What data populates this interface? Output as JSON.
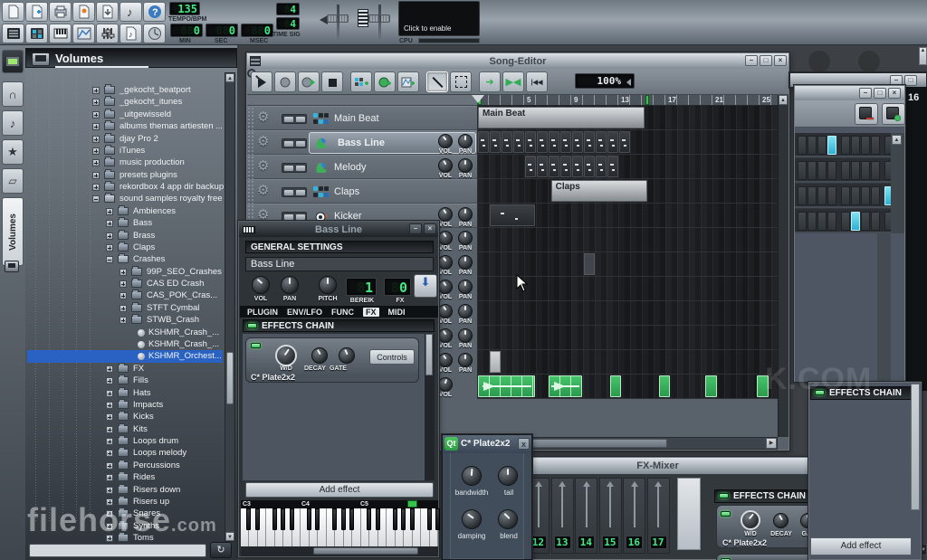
{
  "colors": {
    "accent_blue": "#2a62c4",
    "led_green": "#49e06a",
    "lcd_green": "#43e883",
    "sample_green": "#2fae54",
    "step_cyan": "#45c8e6"
  },
  "toolbar": {
    "row1_icons": [
      "new-project",
      "open-project",
      "save-project",
      "project-versions",
      "export-project",
      "export-midi",
      "help"
    ],
    "row2_icons": [
      "song-editor-toggle",
      "bb-editor-toggle",
      "piano-roll-toggle",
      "automation-editor-toggle",
      "fx-mixer-toggle",
      "project-notes-toggle",
      "controller-rack-toggle"
    ],
    "tempo": {
      "value": "135",
      "label": "TEMPO/BPM"
    },
    "counters": [
      {
        "value": "0",
        "label": "MIN"
      },
      {
        "value": "0",
        "label": "SEC"
      },
      {
        "value": "0",
        "label": "MSEC"
      }
    ],
    "timesig": {
      "num": "4",
      "den": "4",
      "label": "TIME SIG"
    },
    "master_sliders": [
      "master-volume",
      "master-pitch"
    ],
    "visualizer": {
      "text": "Click to enable"
    },
    "cpu": {
      "label": "CPU"
    }
  },
  "browser": {
    "title": "Volumes",
    "rail_icons": [
      "instrument-plugins",
      "samples-headphones",
      "presets-note",
      "favorites-star",
      "home-folder"
    ],
    "rail_tab_label": "Volumes",
    "search_value": "",
    "tree": [
      {
        "label": "_gekocht_beatport",
        "depth": 5,
        "icon": "folder"
      },
      {
        "label": "_gekocht_itunes",
        "depth": 5,
        "icon": "folder"
      },
      {
        "label": "_uitgewisseld",
        "depth": 5,
        "icon": "folder"
      },
      {
        "label": "albums themas artiesten ...",
        "depth": 5,
        "icon": "folder"
      },
      {
        "label": "djay Pro 2",
        "depth": 5,
        "icon": "folder"
      },
      {
        "label": "iTunes",
        "depth": 5,
        "icon": "folder"
      },
      {
        "label": "music production",
        "depth": 5,
        "icon": "folder"
      },
      {
        "label": "presets plugins",
        "depth": 5,
        "icon": "folder"
      },
      {
        "label": "rekordbox 4 app dir backup",
        "depth": 5,
        "icon": "folder"
      },
      {
        "label": "sound samples royalty free",
        "depth": 5,
        "icon": "folder-open"
      },
      {
        "label": "Ambiences",
        "depth": 6,
        "icon": "folder"
      },
      {
        "label": "Bass",
        "depth": 6,
        "icon": "folder"
      },
      {
        "label": "Brass",
        "depth": 6,
        "icon": "folder"
      },
      {
        "label": "Claps",
        "depth": 6,
        "icon": "folder"
      },
      {
        "label": "Crashes",
        "depth": 6,
        "icon": "folder-open"
      },
      {
        "label": "99P_SEO_Crashes",
        "depth": 7,
        "icon": "folder"
      },
      {
        "label": "CAS ED Crash",
        "depth": 7,
        "icon": "folder"
      },
      {
        "label": "CAS_POK_Cras...",
        "depth": 7,
        "icon": "folder"
      },
      {
        "label": "STFT Cymbal",
        "depth": 7,
        "icon": "folder"
      },
      {
        "label": "STWB_Crash",
        "depth": 7,
        "icon": "folder"
      },
      {
        "label": "KSHMR_Crash_...",
        "depth": 8,
        "icon": "sample"
      },
      {
        "label": "KSHMR_Crash_...",
        "depth": 8,
        "icon": "sample"
      },
      {
        "label": "KSHMR_Orchest...",
        "depth": 8,
        "icon": "sample",
        "selected": true
      },
      {
        "label": "FX",
        "depth": 6,
        "icon": "folder"
      },
      {
        "label": "Fills",
        "depth": 6,
        "icon": "folder"
      },
      {
        "label": "Hats",
        "depth": 6,
        "icon": "folder"
      },
      {
        "label": "Impacts",
        "depth": 6,
        "icon": "folder"
      },
      {
        "label": "Kicks",
        "depth": 6,
        "icon": "folder"
      },
      {
        "label": "Kits",
        "depth": 6,
        "icon": "folder"
      },
      {
        "label": "Loops drum",
        "depth": 6,
        "icon": "folder"
      },
      {
        "label": "Loops melody",
        "depth": 6,
        "icon": "folder"
      },
      {
        "label": "Percussions",
        "depth": 6,
        "icon": "folder"
      },
      {
        "label": "Rides",
        "depth": 6,
        "icon": "folder"
      },
      {
        "label": "Risers down",
        "depth": 6,
        "icon": "folder"
      },
      {
        "label": "Risers up",
        "depth": 6,
        "icon": "folder"
      },
      {
        "label": "Snares",
        "depth": 6,
        "icon": "folder"
      },
      {
        "label": "Synths",
        "depth": 6,
        "icon": "folder"
      },
      {
        "label": "Toms",
        "depth": 6,
        "icon": "folder"
      }
    ]
  },
  "song_editor": {
    "title": "Song-Editor",
    "toolbar_icons": [
      "play",
      "record",
      "record-play",
      "stop",
      "add-bb-track",
      "add-sample-track",
      "add-automation-track",
      "draw-mode",
      "edit-mode",
      "next-state",
      "loop-points",
      "rewind",
      "zoom"
    ],
    "zoom_value": "100%",
    "timeline_labels": [
      "5",
      "9",
      "13",
      "17",
      "21",
      "25"
    ],
    "knob_caption_vol": "VOL",
    "knob_caption_pan": "PAN",
    "tracks": [
      {
        "name": "Main Beat",
        "icon": "beat-pattern",
        "knobs": false
      },
      {
        "name": "Bass Line",
        "icon": "instrument-colorful",
        "knobs": true,
        "selected": true
      },
      {
        "name": "Melody",
        "icon": "instrument-colorful",
        "knobs": true
      },
      {
        "name": "Claps",
        "icon": "beat-pattern",
        "knobs": false
      },
      {
        "name": "Kicker",
        "icon": "kicker-ball",
        "knobs": true
      }
    ],
    "hidden_knob_rows": 6,
    "segments": [
      {
        "row": 0,
        "start": 1,
        "len": 14.2,
        "kind": "named",
        "label": "Main Beat"
      },
      {
        "row": 1,
        "start": 1,
        "count": 13,
        "kind": "patterns"
      },
      {
        "row": 2,
        "start": 5,
        "count": 8,
        "kind": "patterns"
      },
      {
        "row": 3,
        "start": 7.2,
        "len": 8.3,
        "kind": "named",
        "label": "Claps"
      },
      {
        "row": 4,
        "start": 2,
        "len": 3.9,
        "kind": "pattern-wide"
      },
      {
        "row": 6,
        "start": 10,
        "len": 1,
        "kind": "block-gray"
      },
      {
        "row": 10,
        "start": 2,
        "len": 1,
        "kind": "block-white"
      },
      {
        "row": 11,
        "start": 1,
        "len": 4.9,
        "kind": "sample-wave"
      },
      {
        "row": 11,
        "start": 7,
        "len": 2.9,
        "kind": "sample-wave"
      },
      {
        "row": 11,
        "start": 12.2,
        "len": 1,
        "kind": "sample-cell"
      },
      {
        "row": 11,
        "start": 16.4,
        "len": 1,
        "kind": "sample-cell"
      },
      {
        "row": 11,
        "start": 20.3,
        "len": 1.1,
        "kind": "sample-cell"
      },
      {
        "row": 11,
        "start": 24.7,
        "len": 1.1,
        "kind": "sample-cell"
      }
    ]
  },
  "instrument": {
    "title": "Bass Line",
    "section_label": "GENERAL SETTINGS",
    "name_value": "Bass Line",
    "knobs": [
      "VOL",
      "PAN",
      "PITCH"
    ],
    "lcds": [
      {
        "value": "1",
        "label": "BEREIK"
      },
      {
        "value": "0",
        "label": "FX"
      }
    ],
    "tabs": [
      {
        "label": "PLUGIN"
      },
      {
        "label": "ENV/LFO"
      },
      {
        "label": "FUNC"
      },
      {
        "label": "FX",
        "active": true
      },
      {
        "label": "MIDI"
      }
    ],
    "chain": {
      "header": "EFFECTS CHAIN",
      "effect": {
        "name": "C* Plate2x2",
        "knobs": [
          "W/D",
          "DECAY",
          "GATE"
        ],
        "button": "Controls"
      },
      "add_button": "Add effect"
    },
    "piano_octaves": [
      "C3",
      "C4",
      "C5"
    ]
  },
  "fx_mixer": {
    "title": "FX-Mixer",
    "channels": [
      "12",
      "13",
      "14",
      "15",
      "16",
      "17"
    ],
    "chain": {
      "header": "EFFECTS CHAIN",
      "effect": {
        "name": "C* Plate2x2",
        "knobs": [
          "W/D",
          "DECAY",
          "GATE"
        ]
      }
    }
  },
  "chain_window": {
    "header": "EFFECTS CHAIN",
    "add_button": "Add effect"
  },
  "plate": {
    "logo": "Qt",
    "title": "C* Plate2x2",
    "close": "x",
    "knobs": [
      "bandwidth",
      "tail",
      "damping",
      "blend"
    ]
  },
  "beat_editor": {
    "cells_per_row": 9,
    "rows": [
      {
        "active": [
          3
        ]
      },
      {
        "active": []
      },
      {
        "active": [
          8
        ]
      },
      {
        "active": [
          5
        ]
      }
    ],
    "side_lcd": "16"
  },
  "watermarks": {
    "main": "filehorse",
    "suffix": ".com",
    "side": "K.COM"
  }
}
